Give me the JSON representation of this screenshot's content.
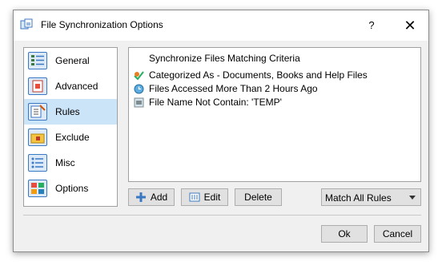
{
  "window": {
    "title": "File Synchronization Options",
    "help_label": "?",
    "close_label": "✕"
  },
  "sidebar": {
    "items": [
      {
        "label": "General",
        "icon": "general-icon"
      },
      {
        "label": "Advanced",
        "icon": "advanced-icon"
      },
      {
        "label": "Rules",
        "icon": "rules-icon",
        "selected": true
      },
      {
        "label": "Exclude",
        "icon": "exclude-icon"
      },
      {
        "label": "Misc",
        "icon": "misc-icon"
      },
      {
        "label": "Options",
        "icon": "options-icon"
      }
    ]
  },
  "rules": {
    "header": "Synchronize Files Matching Criteria",
    "items": [
      {
        "text": "Categorized As - Documents, Books and Help Files",
        "icon": "category-icon"
      },
      {
        "text": "Files Accessed More Than 2 Hours Ago",
        "icon": "clock-icon"
      },
      {
        "text": "File Name Not Contain: 'TEMP'",
        "icon": "file-name-icon"
      }
    ]
  },
  "actions": {
    "add_label": "Add",
    "edit_label": "Edit",
    "delete_label": "Delete",
    "match_select": "Match All Rules"
  },
  "footer": {
    "ok_label": "Ok",
    "cancel_label": "Cancel"
  },
  "colors": {
    "selection": "#cce4f7",
    "accent": "#3b78c2"
  }
}
